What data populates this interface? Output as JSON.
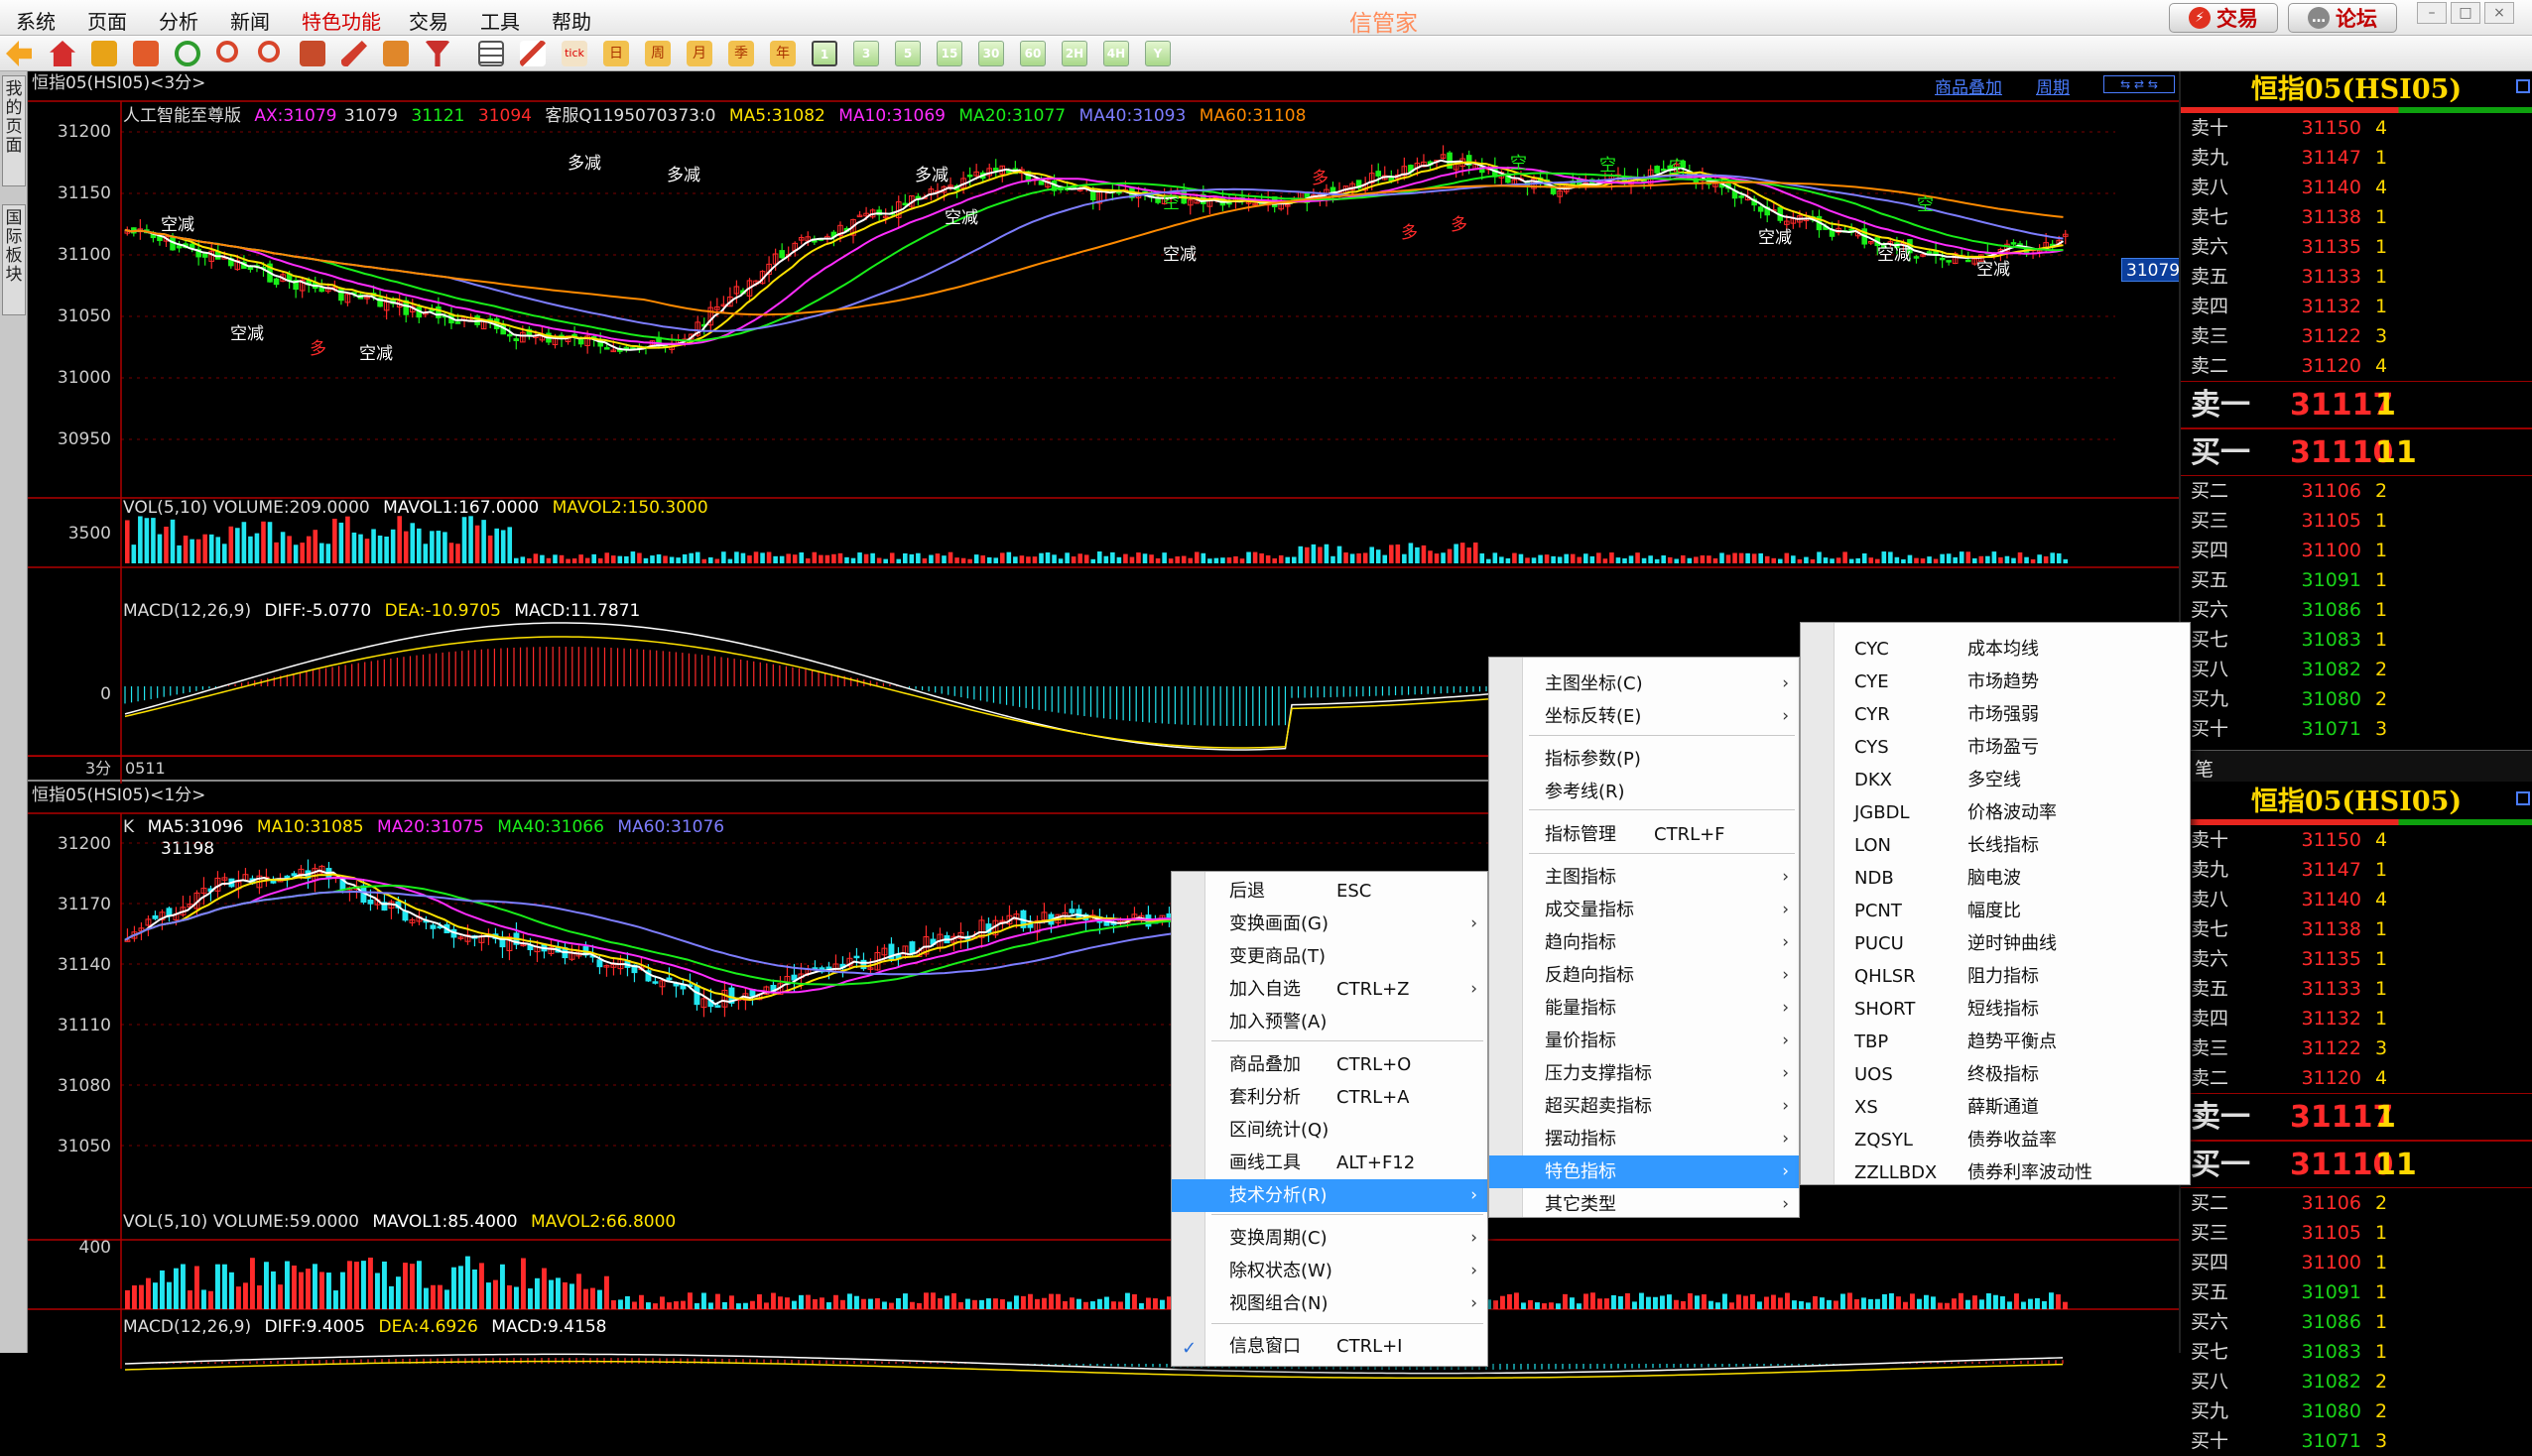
{
  "menubar": {
    "items": [
      "系统",
      "页面",
      "分析",
      "新闻",
      "特色功能",
      "交易",
      "工具",
      "帮助"
    ],
    "brand": "信管家",
    "trade_button": "交易",
    "forum_button": "论坛"
  },
  "toolbar": {
    "period_buttons": [
      "1",
      "3",
      "5",
      "15",
      "30",
      "60",
      "2H",
      "4H",
      "Y"
    ]
  },
  "side_tabs": [
    "我的页面",
    "国际板块"
  ],
  "chart_top": {
    "title": "恒指05(HSI05)<3分>",
    "links": [
      "商品叠加",
      "周期"
    ],
    "legend_label": "人工智能至尊版",
    "ax_label": "AX:31079",
    "ax_v1": "31079",
    "ax_v2": "31121",
    "ax_v3": "31094",
    "custom": "客服Q1195070373:0",
    "ma5": "MA5:31082",
    "ma10": "MA10:31069",
    "ma20": "MA20:31077",
    "ma40": "MA40:31093",
    "ma60": "MA60:31108",
    "price_ticks": [
      "31200",
      "31150",
      "31100",
      "31050",
      "31000",
      "30950"
    ],
    "price_tag": "31079",
    "signals": {
      "duo": "多",
      "kong": "空",
      "duo_jian": "多减",
      "kong_jian": "空减"
    },
    "vol_legend": "VOL(5,10) VOLUME:209.0000",
    "vol_mavol1": "MAVOL1:167.0000",
    "vol_mavol2": "MAVOL2:150.3000",
    "vol_tick": "3500",
    "macd_legend": "MACD(12,26,9)",
    "macd_diff": "DIFF:-5.0770",
    "macd_dea": "DEA:-10.9705",
    "macd_val": "MACD:11.7871",
    "macd_tick": "0",
    "footer_left": "3分",
    "footer_date": "0511"
  },
  "chart_bottom": {
    "title": "恒指05(HSI05)<1分>",
    "k_label": "K",
    "ma5": "MA5:31096",
    "ma10": "MA10:31085",
    "ma20": "MA20:31075",
    "ma40": "MA40:31066",
    "ma60": "MA60:31076",
    "high_label": "31198",
    "price_ticks": [
      "31200",
      "31170",
      "31140",
      "31110",
      "31080",
      "31050"
    ],
    "vol_legend": "VOL(5,10) VOLUME:59.0000",
    "vol_mavol1": "MAVOL1:85.4000",
    "vol_mavol2": "MAVOL2:66.8000",
    "vol_tick": "400",
    "macd_legend": "MACD(12,26,9)",
    "macd_diff": "DIFF:9.4005",
    "macd_dea": "DEA:4.6926",
    "macd_val": "MACD:9.4158"
  },
  "orderbook": {
    "title": "恒指05(HSI05)",
    "asks": [
      {
        "label": "卖十",
        "price": "31150",
        "vol": "4"
      },
      {
        "label": "卖九",
        "price": "31147",
        "vol": "1"
      },
      {
        "label": "卖八",
        "price": "31140",
        "vol": "4"
      },
      {
        "label": "卖七",
        "price": "31138",
        "vol": "1"
      },
      {
        "label": "卖六",
        "price": "31135",
        "vol": "1"
      },
      {
        "label": "卖五",
        "price": "31133",
        "vol": "1"
      },
      {
        "label": "卖四",
        "price": "31132",
        "vol": "1"
      },
      {
        "label": "卖三",
        "price": "31122",
        "vol": "3"
      },
      {
        "label": "卖二",
        "price": "31120",
        "vol": "4"
      }
    ],
    "ask1": {
      "label": "卖一",
      "price": "31117",
      "vol": "1"
    },
    "bid1": {
      "label": "买一",
      "price": "31110",
      "vol": "11"
    },
    "bids": [
      {
        "label": "买二",
        "price": "31106",
        "vol": "2"
      },
      {
        "label": "买三",
        "price": "31105",
        "vol": "1"
      },
      {
        "label": "买四",
        "price": "31100",
        "vol": "1"
      },
      {
        "label": "买五",
        "price": "31091",
        "vol": "1"
      },
      {
        "label": "买六",
        "price": "31086",
        "vol": "1"
      },
      {
        "label": "买七",
        "price": "31083",
        "vol": "1"
      },
      {
        "label": "买八",
        "price": "31082",
        "vol": "2"
      },
      {
        "label": "买九",
        "price": "31080",
        "vol": "2"
      },
      {
        "label": "买十",
        "price": "31071",
        "vol": "3"
      }
    ],
    "bottom_tab": "笔"
  },
  "context_menu": [
    {
      "label": "后退",
      "shortcut": "ESC"
    },
    {
      "label": "变换画面(G)",
      "arrow": "›"
    },
    {
      "label": "变更商品(T)"
    },
    {
      "label": "加入自选",
      "shortcut": "CTRL+Z",
      "arrow": "›"
    },
    {
      "label": "加入预警(A)"
    },
    {
      "label": "商品叠加",
      "shortcut": "CTRL+O"
    },
    {
      "label": "套利分析",
      "shortcut": "CTRL+A"
    },
    {
      "label": "区间统计(Q)"
    },
    {
      "label": "画线工具",
      "shortcut": "ALT+F12"
    },
    {
      "label": "技术分析(R)",
      "arrow": "›"
    },
    {
      "label": "变换周期(C)",
      "arrow": "›"
    },
    {
      "label": "除权状态(W)",
      "arrow": "›"
    },
    {
      "label": "视图组合(N)",
      "arrow": "›"
    },
    {
      "label": "信息窗口",
      "shortcut": "CTRL+I"
    }
  ],
  "submenu_tech": [
    {
      "label": "主图坐标(C)",
      "arrow": "›"
    },
    {
      "label": "坐标反转(E)",
      "arrow": "›"
    },
    {
      "label": "指标参数(P)"
    },
    {
      "label": "参考线(R)"
    },
    {
      "label": "指标管理",
      "shortcut": "CTRL+F"
    },
    {
      "label": "主图指标",
      "arrow": "›"
    },
    {
      "label": "成交量指标",
      "arrow": "›"
    },
    {
      "label": "趋向指标",
      "arrow": "›"
    },
    {
      "label": "反趋向指标",
      "arrow": "›"
    },
    {
      "label": "能量指标",
      "arrow": "›"
    },
    {
      "label": "量价指标",
      "arrow": "›"
    },
    {
      "label": "压力支撑指标",
      "arrow": "›"
    },
    {
      "label": "超买超卖指标",
      "arrow": "›"
    },
    {
      "label": "摆动指标",
      "arrow": "›"
    },
    {
      "label": "特色指标",
      "arrow": "›"
    },
    {
      "label": "其它类型",
      "arrow": "›"
    }
  ],
  "submenu_special": [
    {
      "code": "CYC",
      "name": "成本均线"
    },
    {
      "code": "CYE",
      "name": "市场趋势"
    },
    {
      "code": "CYR",
      "name": "市场强弱"
    },
    {
      "code": "CYS",
      "name": "市场盈亏"
    },
    {
      "code": "DKX",
      "name": "多空线"
    },
    {
      "code": "JGBDL",
      "name": "价格波动率"
    },
    {
      "code": "LON",
      "name": "长线指标"
    },
    {
      "code": "NDB",
      "name": "脑电波"
    },
    {
      "code": "PCNT",
      "name": "幅度比"
    },
    {
      "code": "PUCU",
      "name": "逆时钟曲线"
    },
    {
      "code": "QHLSR",
      "name": "阻力指标"
    },
    {
      "code": "SHORT",
      "name": "短线指标"
    },
    {
      "code": "TBP",
      "name": "趋势平衡点"
    },
    {
      "code": "UOS",
      "name": "终极指标"
    },
    {
      "code": "XS",
      "name": "薛斯通道"
    },
    {
      "code": "ZQSYL",
      "name": "债券收益率"
    },
    {
      "code": "ZZLLBDX",
      "name": "债券利率波动性"
    }
  ],
  "colors": {
    "up": "#ff2a2a",
    "down": "#22e6f0",
    "down_top": "#19ee19",
    "ma5": "#ffffff",
    "ma10": "#ffe300",
    "ma20": "#ff2cff",
    "ma40": "#2ccf2c",
    "ma60": "#ff8a00"
  }
}
